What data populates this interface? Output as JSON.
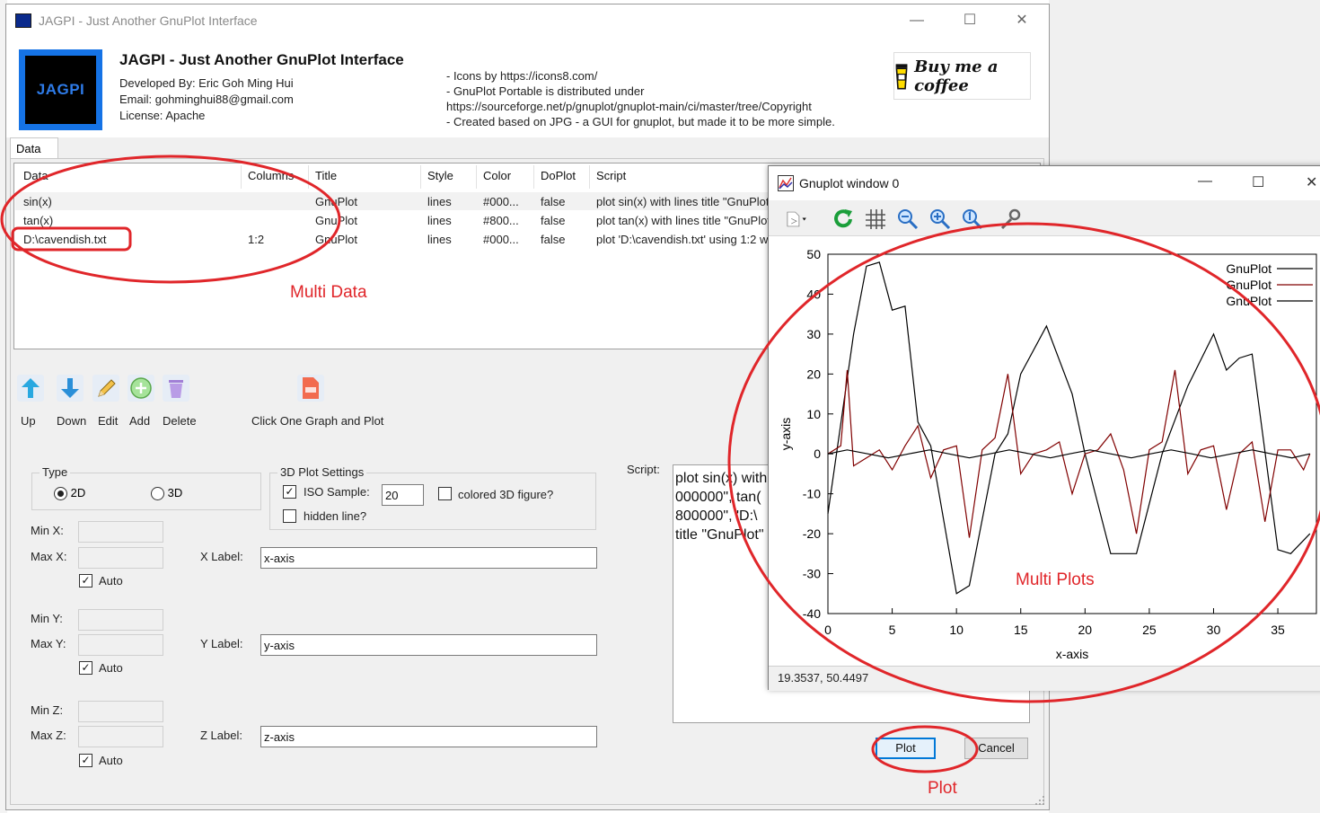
{
  "window": {
    "title": "JAGPI - Just Another GnuPlot Interface"
  },
  "header": {
    "logo_text": "JAGPI",
    "app_title": "JAGPI - Just Another GnuPlot Interface",
    "developer": "Developed By: Eric Goh Ming Hui",
    "email": "Email: gohminghui88@gmail.com",
    "license": "License: Apache",
    "info": [
      "- Icons by https://icons8.com/",
      "- GnuPlot Portable is distributed under",
      "https://sourceforge.net/p/gnuplot/gnuplot-main/ci/master/tree/Copyright",
      "- Created based on JPG - a GUI for gnuplot, but made it to be more simple."
    ],
    "coffee": "Buy me a coffee"
  },
  "tab": "Data",
  "grid": {
    "columns": [
      "Data",
      "Columns",
      "Title",
      "Style",
      "Color",
      "DoPlot",
      "Script"
    ],
    "rows": [
      [
        "sin(x)",
        "",
        "GnuPlot",
        "lines",
        "#000...",
        "false",
        "plot sin(x) with lines title \"GnuPlot"
      ],
      [
        "tan(x)",
        "",
        "GnuPlot",
        "lines",
        "#800...",
        "false",
        "plot tan(x) with lines title \"GnuPlot"
      ],
      [
        "D:\\cavendish.txt",
        "1:2",
        "GnuPlot",
        "lines",
        "#000...",
        "false",
        "plot 'D:\\cavendish.txt' using 1:2 w"
      ]
    ]
  },
  "toolbar": {
    "up": "Up",
    "down": "Down",
    "edit": "Edit",
    "add": "Add",
    "delete": "Delete",
    "click_one": "Click One Graph and Plot"
  },
  "type_group": {
    "title": "Type",
    "opt_2d": "2D",
    "opt_3d": "3D"
  },
  "settings3d": {
    "title": "3D Plot Settings",
    "iso_label": "ISO Sample:",
    "iso_value": "20",
    "colored": "colored 3D figure?",
    "hidden": "hidden line?"
  },
  "axes": {
    "min_x": "Min X:",
    "max_x": "Max X:",
    "x_label": "X Label:",
    "x_value": "x-axis",
    "min_y": "Min Y:",
    "max_y": "Max Y:",
    "y_label": "Y Label:",
    "y_value": "y-axis",
    "min_z": "Min Z:",
    "max_z": "Max Z:",
    "z_label": "Z Label:",
    "z_value": "z-axis",
    "auto": "Auto"
  },
  "script": {
    "label": "Script:",
    "text": "plot sin(x) with\n000000\", tan(\n800000\", 'D:\\\ntitle \"GnuPlot\""
  },
  "buttons": {
    "plot": "Plot",
    "cancel": "Cancel"
  },
  "gnuplot": {
    "title": "Gnuplot window 0",
    "status": "19.3537,  50.4497",
    "xlabel": "x-axis",
    "ylabel": "y-axis",
    "legend": [
      "GnuPlot",
      "GnuPlot",
      "GnuPlot"
    ],
    "colors": [
      "#000000",
      "#800000",
      "#000000"
    ]
  },
  "annotations": {
    "multi_data": "Multi Data",
    "multi_plots": "Multi Plots",
    "plot": "Plot"
  },
  "chart_data": {
    "type": "line",
    "title": "",
    "xlabel": "x-axis",
    "ylabel": "y-axis",
    "xlim": [
      0,
      38
    ],
    "ylim": [
      -40,
      50
    ],
    "xticks": [
      0,
      5,
      10,
      15,
      20,
      25,
      30,
      35
    ],
    "yticks": [
      -40,
      -30,
      -20,
      -10,
      0,
      10,
      20,
      30,
      40,
      50
    ],
    "series": [
      {
        "name": "GnuPlot",
        "color": "#000000",
        "x": [
          0,
          2,
          3,
          4,
          5,
          6,
          7,
          8,
          10,
          11,
          13,
          14,
          15,
          17,
          19,
          20,
          22,
          24,
          26,
          28,
          30,
          31,
          32,
          33,
          35,
          36,
          37.5
        ],
        "y": [
          -15,
          30,
          47,
          48,
          36,
          37,
          8,
          2,
          -35,
          -33,
          0,
          5,
          20,
          32,
          15,
          0,
          -25,
          -25,
          0,
          17,
          30,
          21,
          24,
          25,
          -24,
          -25,
          -20
        ]
      },
      {
        "name": "GnuPlot",
        "color": "#800000",
        "x": [
          0,
          1,
          1.5,
          2,
          4,
          5,
          6,
          7,
          8,
          9,
          10,
          11,
          12,
          13,
          14,
          15,
          16,
          17,
          18,
          19,
          20,
          21,
          22,
          23,
          24,
          25,
          26,
          27,
          28,
          29,
          30,
          31,
          32,
          33,
          34,
          35,
          36,
          37,
          37.5
        ],
        "y": [
          0,
          2,
          21,
          -3,
          1,
          -4,
          2,
          7,
          -6,
          1,
          2,
          -21,
          1,
          4,
          20,
          -5,
          0,
          1,
          3,
          -10,
          0,
          1,
          5,
          -4,
          -20,
          1,
          3,
          21,
          -5,
          1,
          2,
          -14,
          0,
          3,
          -17,
          1,
          1,
          -4,
          0
        ]
      },
      {
        "name": "GnuPlot",
        "color": "#000000",
        "x": [
          0,
          1.5,
          3.1,
          4.7,
          6.3,
          7.9,
          9.4,
          11,
          12.6,
          14.1,
          15.7,
          17.3,
          18.8,
          20.4,
          22,
          23.6,
          25.1,
          26.7,
          28.3,
          29.8,
          31.4,
          33,
          34.5,
          36.1,
          37.5
        ],
        "y": [
          0,
          1,
          0,
          -1,
          0,
          1,
          0,
          -1,
          0,
          1,
          0,
          -1,
          0,
          1,
          0,
          -1,
          0,
          1,
          0,
          -1,
          0,
          1,
          0,
          -1,
          0
        ]
      }
    ],
    "legend": "top-right",
    "grid": false
  }
}
